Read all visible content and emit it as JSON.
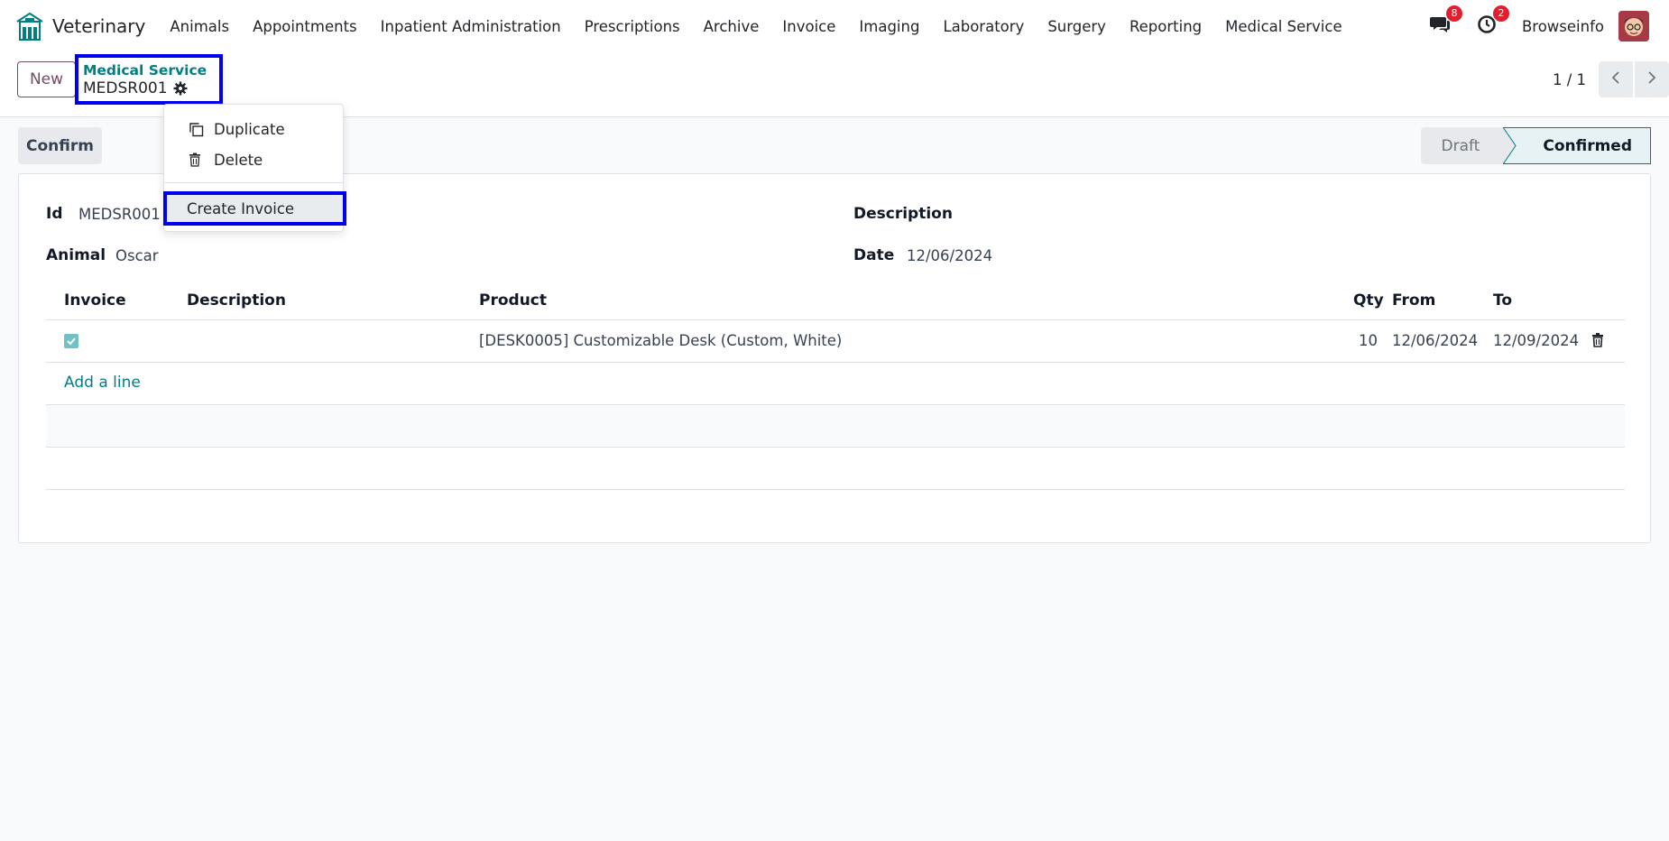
{
  "app": {
    "name": "Veterinary",
    "menu": [
      "Animals",
      "Appointments",
      "Inpatient Administration",
      "Prescriptions",
      "Archive",
      "Invoice",
      "Imaging",
      "Laboratory",
      "Surgery",
      "Reporting",
      "Medical Service"
    ]
  },
  "systray": {
    "messages_count": "8",
    "activities_count": "2",
    "company": "Browseinfo"
  },
  "control_panel": {
    "new_label": "New",
    "breadcrumb_parent": "Medical Service",
    "breadcrumb_current": "MEDSR001",
    "pager_value": "1 / 1"
  },
  "actions_menu": {
    "duplicate": "Duplicate",
    "delete": "Delete",
    "create_invoice": "Create Invoice"
  },
  "statusbar": {
    "confirm_label": "Confirm",
    "stages": [
      "Draft",
      "Confirmed"
    ],
    "active_stage": "Confirmed"
  },
  "form": {
    "id_label": "Id",
    "id_value": "MEDSR001",
    "animal_label": "Animal",
    "animal_value": "Oscar",
    "description_label": "Description",
    "date_label": "Date",
    "date_value": "12/06/2024"
  },
  "lines": {
    "columns": [
      "Invoice",
      "Description",
      "Product",
      "Qty",
      "From",
      "To"
    ],
    "rows": [
      {
        "invoice": true,
        "description": "",
        "product": "[DESK0005] Customizable Desk (Custom, White)",
        "qty": "10",
        "from": "12/06/2024",
        "to": "12/09/2024"
      }
    ],
    "add_line_label": "Add a line"
  },
  "colors": {
    "brand_teal": "#017e84",
    "new_button": "#714b67",
    "highlight_box": "#0000ee",
    "badge_red": "#e0202f"
  }
}
